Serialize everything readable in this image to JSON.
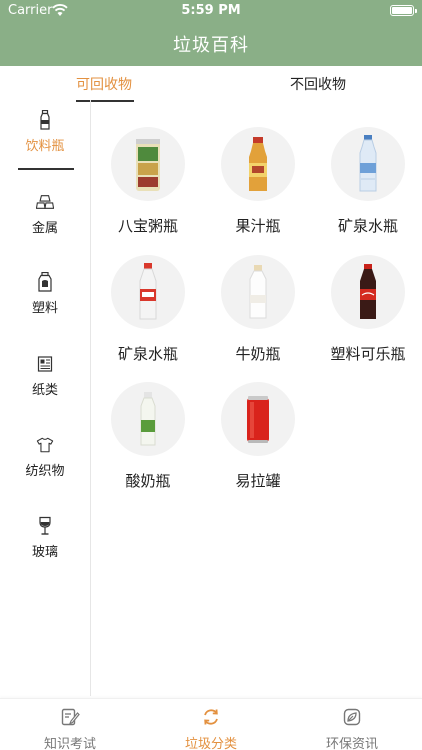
{
  "status_bar": {
    "carrier": "Carrier",
    "time": "5:59 PM"
  },
  "header": {
    "title": "垃圾百科"
  },
  "tabs": [
    {
      "label": "可回收物",
      "active": true
    },
    {
      "label": "不回收物",
      "active": false
    }
  ],
  "categories": [
    {
      "label": "饮料瓶",
      "icon": "bottle-icon",
      "active": true
    },
    {
      "label": "金属",
      "icon": "metal-bars-icon",
      "active": false
    },
    {
      "label": "塑料",
      "icon": "plastic-container-icon",
      "active": false
    },
    {
      "label": "纸类",
      "icon": "newspaper-icon",
      "active": false
    },
    {
      "label": "纺织物",
      "icon": "tshirt-icon",
      "active": false
    },
    {
      "label": "玻璃",
      "icon": "wine-glass-icon",
      "active": false
    }
  ],
  "items": [
    {
      "label": "八宝粥瓶",
      "icon": "porridge-can-icon"
    },
    {
      "label": "果汁瓶",
      "icon": "juice-bottle-icon"
    },
    {
      "label": "矿泉水瓶",
      "icon": "water-bottle-icon"
    },
    {
      "label": "矿泉水瓶",
      "icon": "water-bottle-red-cap-icon"
    },
    {
      "label": "牛奶瓶",
      "icon": "milk-bottle-icon"
    },
    {
      "label": "塑料可乐瓶",
      "icon": "cola-bottle-icon"
    },
    {
      "label": "酸奶瓶",
      "icon": "yogurt-bottle-icon"
    },
    {
      "label": "易拉罐",
      "icon": "soda-can-icon"
    }
  ],
  "tab_bar": [
    {
      "label": "知识考试",
      "icon": "exam-icon",
      "active": false
    },
    {
      "label": "垃圾分类",
      "icon": "recycle-arrows-icon",
      "active": true
    },
    {
      "label": "环保资讯",
      "icon": "news-leaf-icon",
      "active": false
    }
  ],
  "colors": {
    "header": "#8aaf87",
    "accent": "#e39140"
  }
}
